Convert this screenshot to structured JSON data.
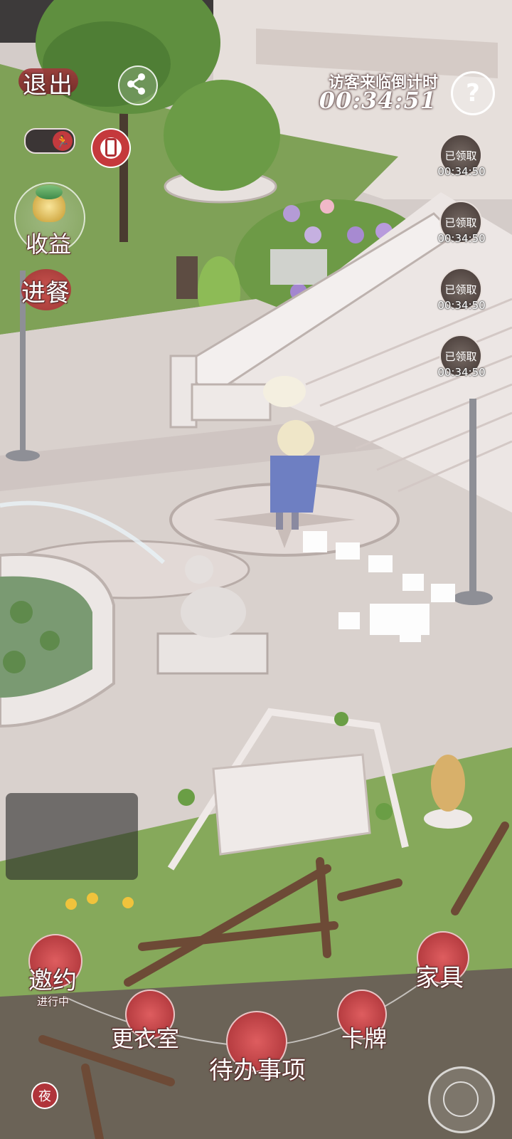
{
  "top_left": {
    "exit_label": "退出",
    "income_label": "收益",
    "meal_label": "进餐"
  },
  "countdown": {
    "title": "访客来临倒计时",
    "time": "00:34:51"
  },
  "help_symbol": "?",
  "visitors": [
    {
      "status": "已领取",
      "time": "00:34:50"
    },
    {
      "status": "已领取",
      "time": "00:34:50"
    },
    {
      "status": "已领取",
      "time": "00:34:50"
    },
    {
      "status": "已领取",
      "time": "00:34:50"
    }
  ],
  "bottom_menu": {
    "invite_label": "邀约",
    "invite_status": "进行中",
    "wardrobe_label": "更衣室",
    "todo_label": "待办事项",
    "cards_label": "卡牌",
    "furniture_label": "家具",
    "night_label": "夜"
  },
  "icons": {
    "share": "share-icon",
    "run": "running-icon",
    "phone": "phone-icon",
    "help": "help-icon",
    "camera": "camera-icon"
  },
  "colors": {
    "accent_red": "#b0343a",
    "grass": "#7fa157",
    "stone": "#d9d1cd"
  }
}
